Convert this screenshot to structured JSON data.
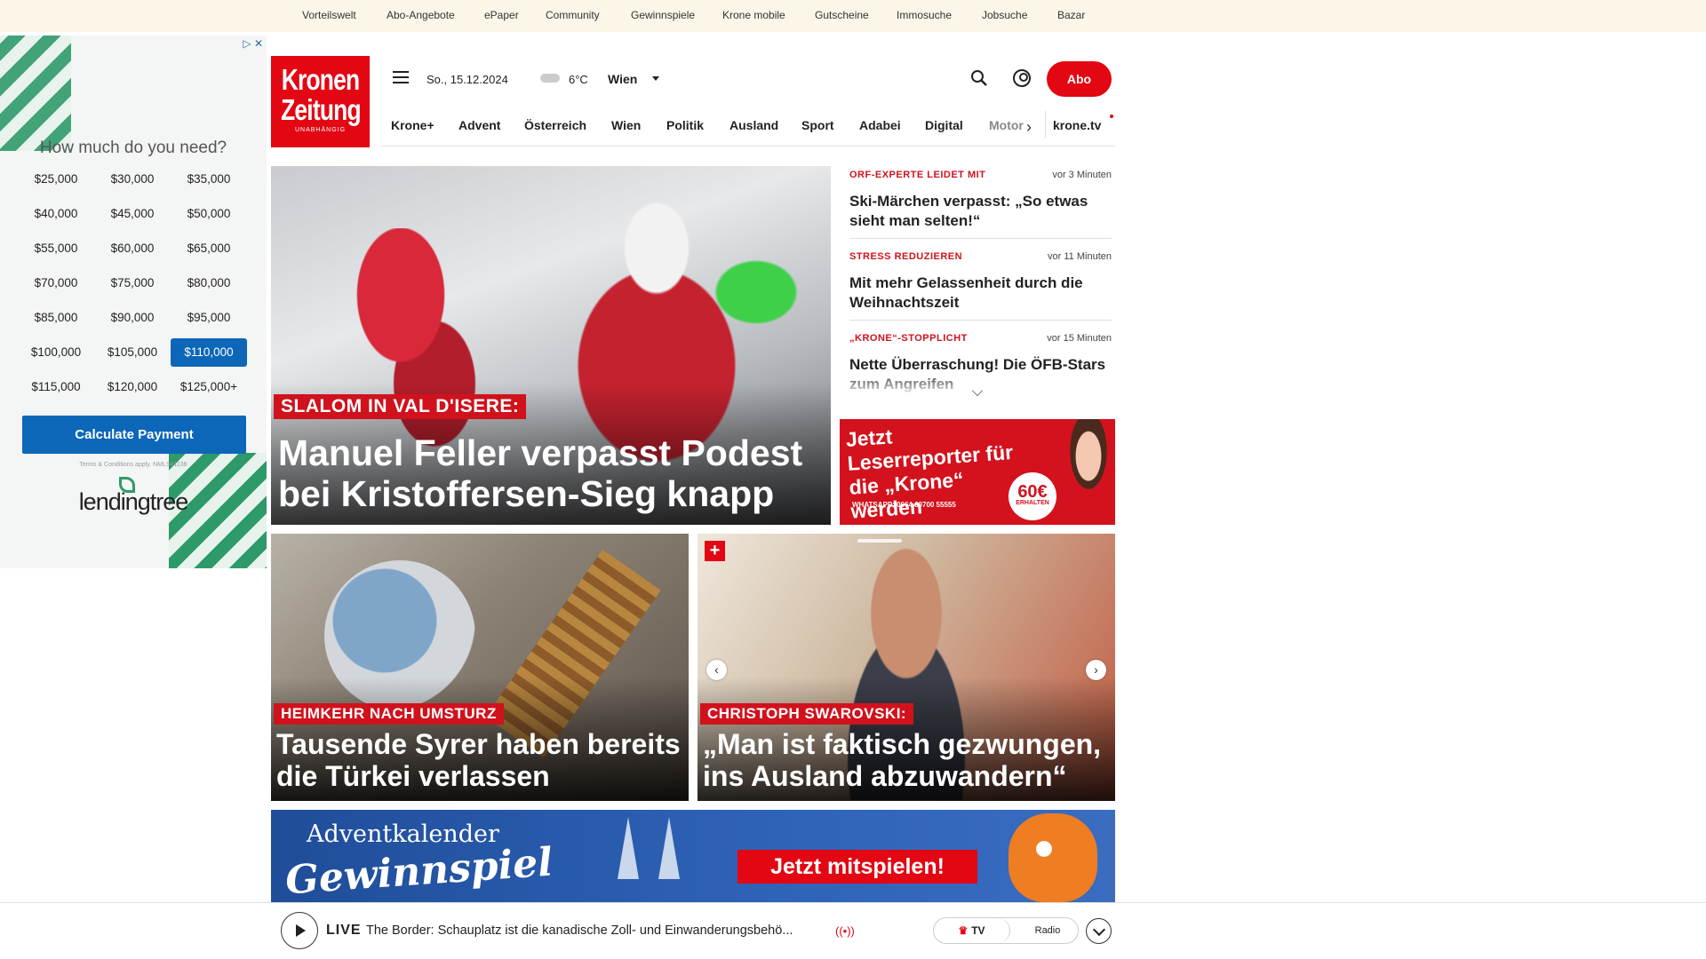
{
  "topbar": {
    "links": [
      "Vorteilswelt",
      "Abo-Angebote",
      "ePaper",
      "Community",
      "Gewinnspiele",
      "Krone mobile",
      "Gutscheine",
      "Immosuche",
      "Jobsuche",
      "Bazar"
    ]
  },
  "ad": {
    "question": "How much do you need?",
    "amounts": [
      "$25,000",
      "$30,000",
      "$35,000",
      "$40,000",
      "$45,000",
      "$50,000",
      "$55,000",
      "$60,000",
      "$65,000",
      "$70,000",
      "$75,000",
      "$80,000",
      "$85,000",
      "$90,000",
      "$95,000",
      "$100,000",
      "$105,000",
      "$110,000",
      "$115,000",
      "$120,000",
      "$125,000+"
    ],
    "selected": "$110,000",
    "cta": "Calculate Payment",
    "terms": "Terms & Conditions apply. NMLS#1136",
    "brand": "lendingtree"
  },
  "header": {
    "logo_line1": "Kronen",
    "logo_line2": "Zeitung",
    "logo_tag": "UNABHÄNGIG",
    "date": "So., 15.12.2024",
    "temperature": "6°C",
    "city": "Wien",
    "abo_label": "Abo"
  },
  "nav": {
    "items": [
      "Krone+",
      "Advent",
      "Österreich",
      "Wien",
      "Politik",
      "Ausland",
      "Sport",
      "Adabei",
      "Digital",
      "Motor"
    ],
    "tv": "krone.tv"
  },
  "hero": {
    "kicker": "SLALOM IN VAL D'ISERE:",
    "title": "Manuel Feller verpasst Podest bei Kristoffersen-Sieg knapp"
  },
  "latest": [
    {
      "kicker": "ORF-EXPERTE LEIDET MIT",
      "time": "vor 3 Minuten",
      "headline": "Ski-Märchen verpasst: „So etwas sieht man selten!“"
    },
    {
      "kicker": "STRESS REDUZIEREN",
      "time": "vor 11 Minuten",
      "headline": "Mit mehr Gelassenheit durch die Weihnachtszeit"
    },
    {
      "kicker": "„KRONE“-STOPPLICHT",
      "time": "vor 15 Minuten",
      "headline": "Nette Überraschung! Die ÖFB-Stars zum Angreifen"
    }
  ],
  "reporter_ad": {
    "headline": "Jetzt Leserreporter für die „Krone“ werden",
    "whatsapp": "WHATSAPP: 0664 60700 55555",
    "amount": "60€",
    "amount_sub": "ERHALTEN"
  },
  "cards": [
    {
      "kicker": "HEIMKEHR NACH UMSTURZ",
      "title": "Tausende Syrer haben bereits die Türkei verlassen"
    },
    {
      "kicker": "CHRISTOPH SWAROVSKI:",
      "title": "„Man ist faktisch gezwungen, ins Ausland abzuwandern“",
      "plus": "+"
    }
  ],
  "advent": {
    "line1": "Adventkalender",
    "line2": "Gewinnspiel",
    "cta": "Jetzt mitspielen!"
  },
  "livebar": {
    "live": "LIVE",
    "text": "The Border: Schauplatz ist die kanadische Zoll- und Einwanderungsbehö...",
    "tv": "TV",
    "radio": "Radio"
  }
}
